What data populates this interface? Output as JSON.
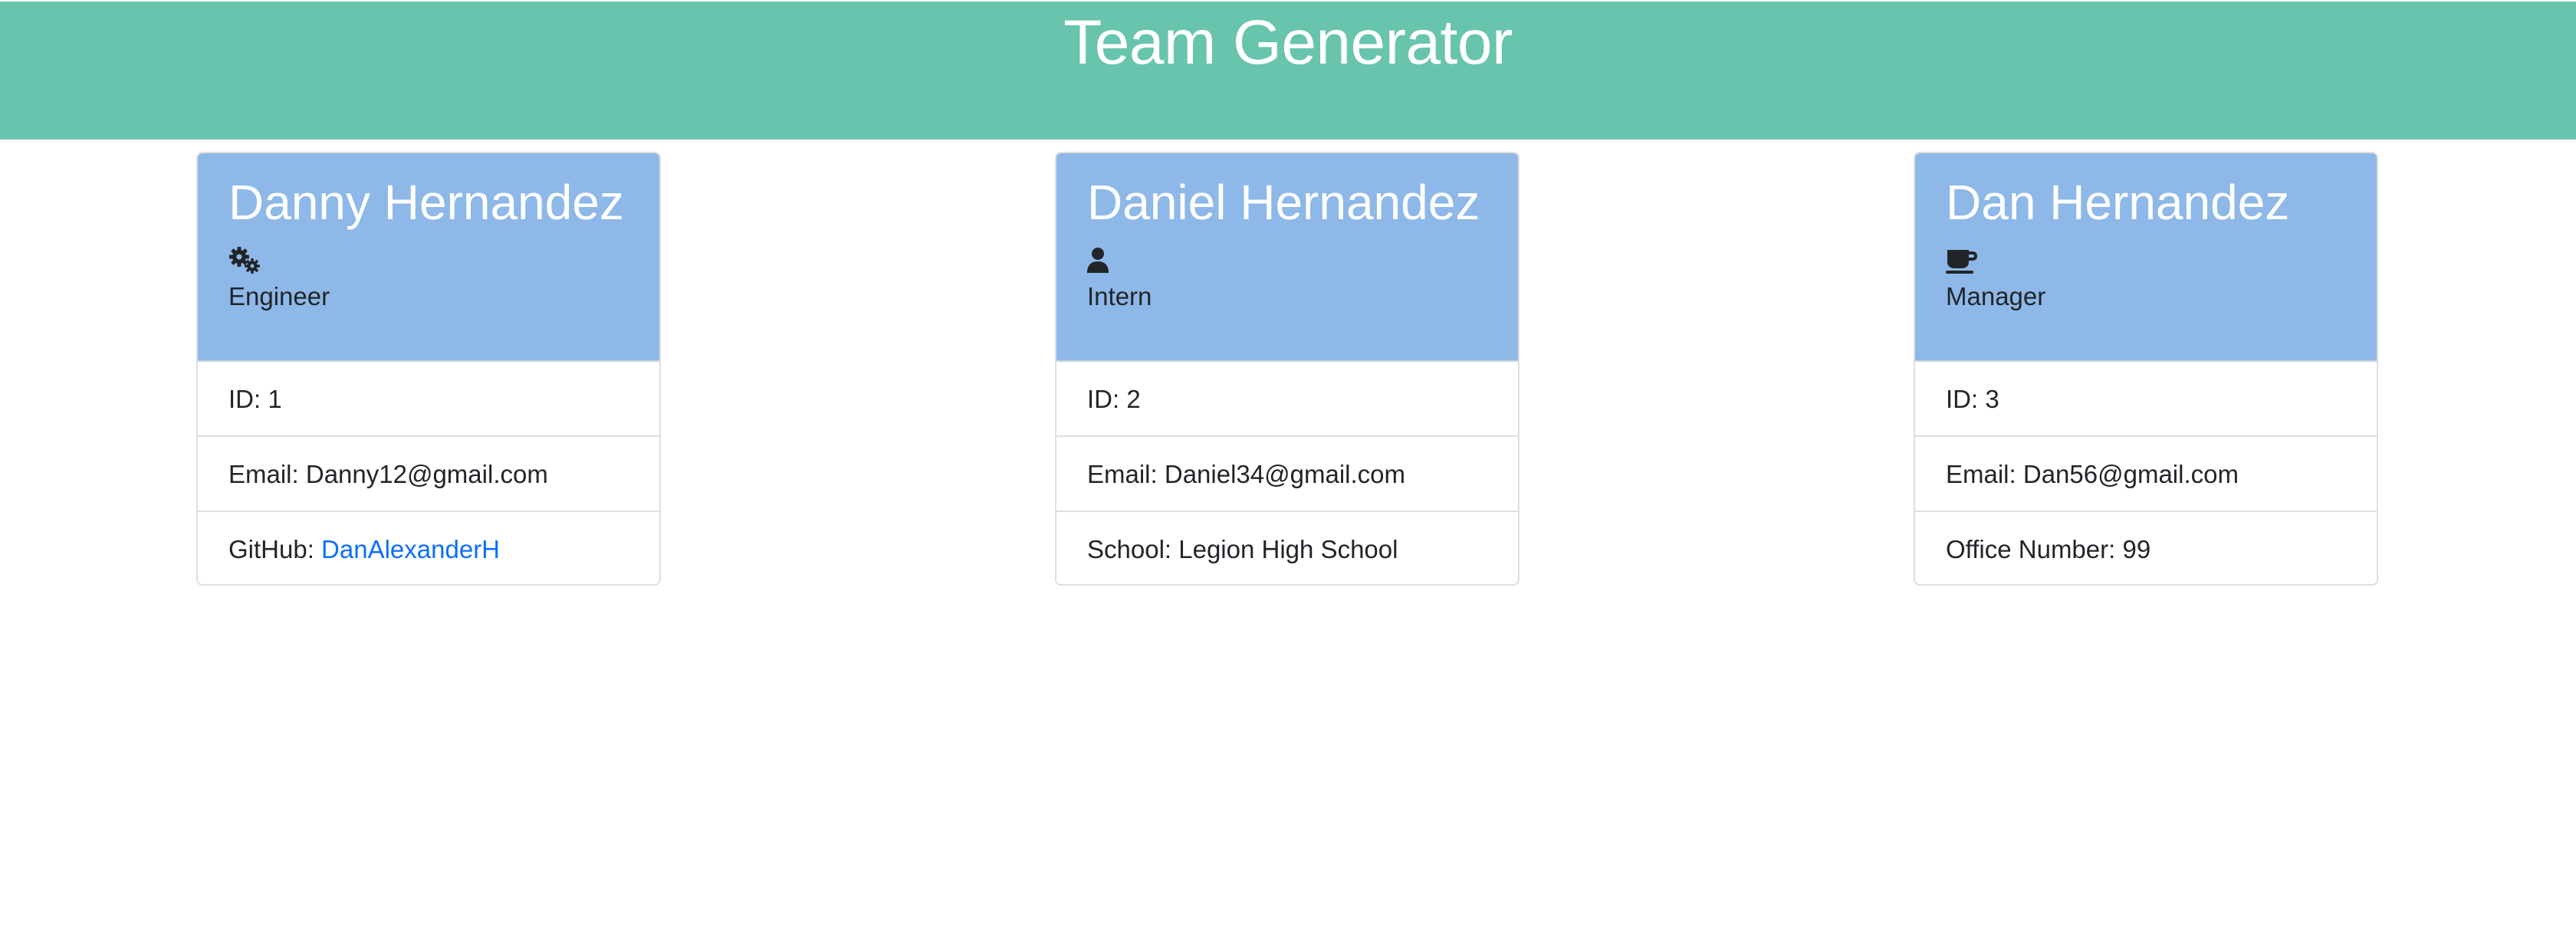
{
  "header": {
    "title": "Team Generator",
    "background_color": "#68c4ad"
  },
  "card_header_color": "#8db8e8",
  "link_color": "#0d6efd",
  "employees": [
    {
      "name": "Danny Hernandez",
      "icon": "gears-icon",
      "role": "Engineer",
      "id_label": "ID:",
      "id": "1",
      "email_label": "Email:",
      "email": "Danny12@gmail.com",
      "extra_label": "GitHub:",
      "extra_value": "DanAlexanderH"
    },
    {
      "name": "Daniel Hernandez",
      "icon": "user-icon",
      "role": "Intern",
      "id_label": "ID:",
      "id": "2",
      "email_label": "Email:",
      "email": "Daniel34@gmail.com",
      "extra_label": "School:",
      "extra_value": "Legion High School"
    },
    {
      "name": "Dan Hernandez",
      "icon": "mug-icon",
      "role": "Manager",
      "id_label": "ID:",
      "id": "3",
      "email_label": "Email:",
      "email": "Dan56@gmail.com",
      "extra_label": "Office Number:",
      "extra_value": "99"
    }
  ]
}
